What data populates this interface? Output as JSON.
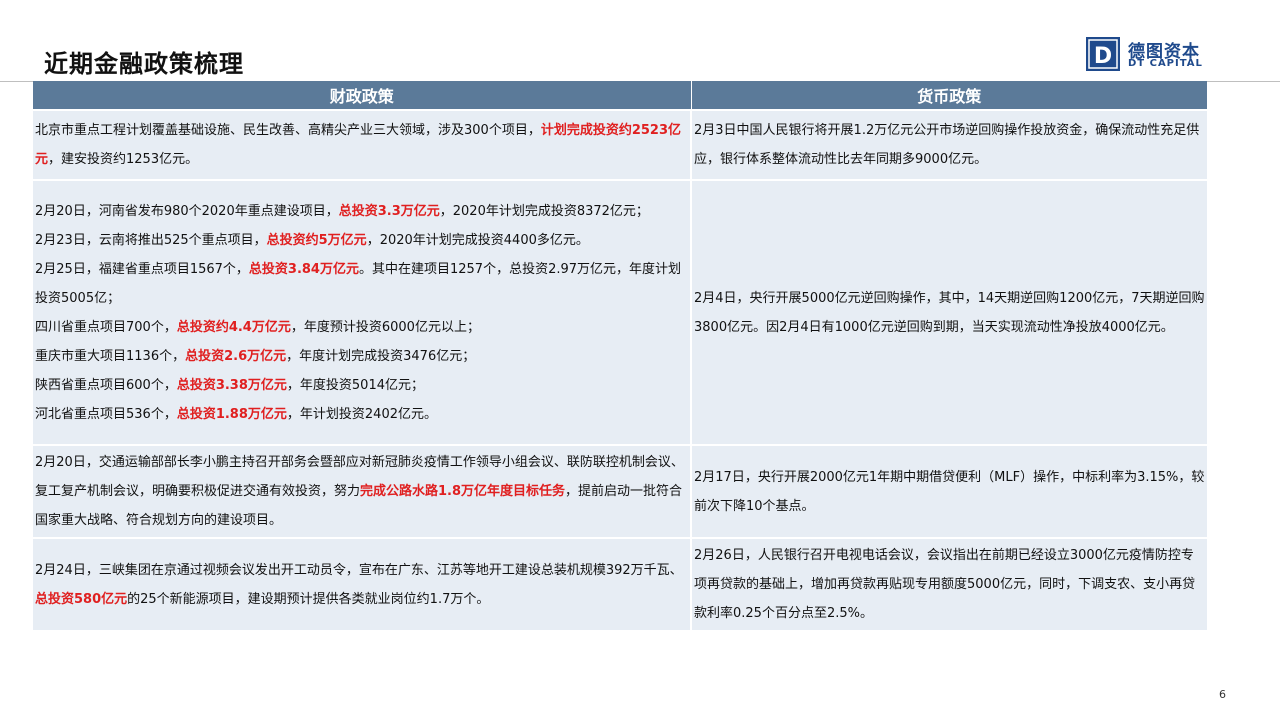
{
  "header": {
    "title": "近期金融政策梳理"
  },
  "logo": {
    "mark_letter": "D",
    "cn": "德图资本",
    "en": "DT CAPITAL"
  },
  "table": {
    "headers": [
      "财政政策",
      "货币政策"
    ],
    "rows": [
      {
        "fiscal": [
          {
            "text": "北京市重点工程计划覆盖基础设施、民生改善、高精尖产业三大领域，涉及300个项目，",
            "hl": "计划完成投资约2523亿元",
            "tail": "，建安投资约1253亿元。"
          }
        ],
        "monetary": "2月3日中国人民银行将开展1.2万亿元公开市场逆回购操作投放资金，确保流动性充足供应，银行体系整体流动性比去年同期多9000亿元。"
      },
      {
        "fiscal": [
          {
            "text": "2月20日，河南省发布980个2020年重点建设项目，",
            "hl": "总投资3.3万亿元",
            "tail": "，2020年计划完成投资8372亿元；"
          },
          {
            "text": "2月23日，云南将推出525个重点项目，",
            "hl": "总投资约5万亿元",
            "tail": "，2020年计划完成投资4400多亿元。"
          },
          {
            "text": "2月25日，福建省重点项目1567个，",
            "hl": "总投资3.84万亿元",
            "tail": "。其中在建项目1257个，总投资2.97万亿元，年度计划投资5005亿；"
          },
          {
            "text": "四川省重点项目700个，",
            "hl": "总投资约4.4万亿元",
            "tail": "，年度预计投资6000亿元以上；"
          },
          {
            "text": "重庆市重大项目1136个，",
            "hl": "总投资2.6万亿元",
            "tail": "，年度计划完成投资3476亿元；"
          },
          {
            "text": "陕西省重点项目600个，",
            "hl": "总投资3.38万亿元",
            "tail": "，年度投资5014亿元；"
          },
          {
            "text": "河北省重点项目536个，",
            "hl": "总投资1.88万亿元",
            "tail": "，年计划投资2402亿元。"
          }
        ],
        "monetary": "2月4日，央行开展5000亿元逆回购操作，其中，14天期逆回购1200亿元，7天期逆回购3800亿元。因2月4日有1000亿元逆回购到期，当天实现流动性净投放4000亿元。"
      },
      {
        "fiscal": [
          {
            "text": "2月20日，交通运输部部长李小鹏主持召开部务会暨部应对新冠肺炎疫情工作领导小组会议、联防联控机制会议、复工复产机制会议，明确要积极促进交通有效投资，努力",
            "hl": "完成公路水路1.8万亿年度目标任务",
            "tail": "，提前启动一批符合国家重大战略、符合规划方向的建设项目。"
          }
        ],
        "monetary": "2月17日，央行开展2000亿元1年期中期借贷便利（MLF）操作，中标利率为3.15%，较前次下降10个基点。"
      },
      {
        "fiscal": [
          {
            "text": "2月24日，三峡集团在京通过视频会议发出开工动员令，宣布在广东、江苏等地开工建设总装机规模392万千瓦、",
            "hl": "总投资580亿元",
            "tail": "的25个新能源项目，建设期预计提供各类就业岗位约1.7万个。"
          }
        ],
        "monetary": "2月26日，人民银行召开电视电话会议，会议指出在前期已经设立3000亿元疫情防控专项再贷款的基础上，增加再贷款再贴现专用额度5000亿元，同时，下调支农、支小再贷款利率0.25个百分点至2.5%。"
      }
    ]
  },
  "page_number": "6",
  "colors": {
    "header_bg": "#5b7a99",
    "cell_bg": "#e7edf4",
    "highlight": "#e02020",
    "brand": "#1f4a8c"
  }
}
